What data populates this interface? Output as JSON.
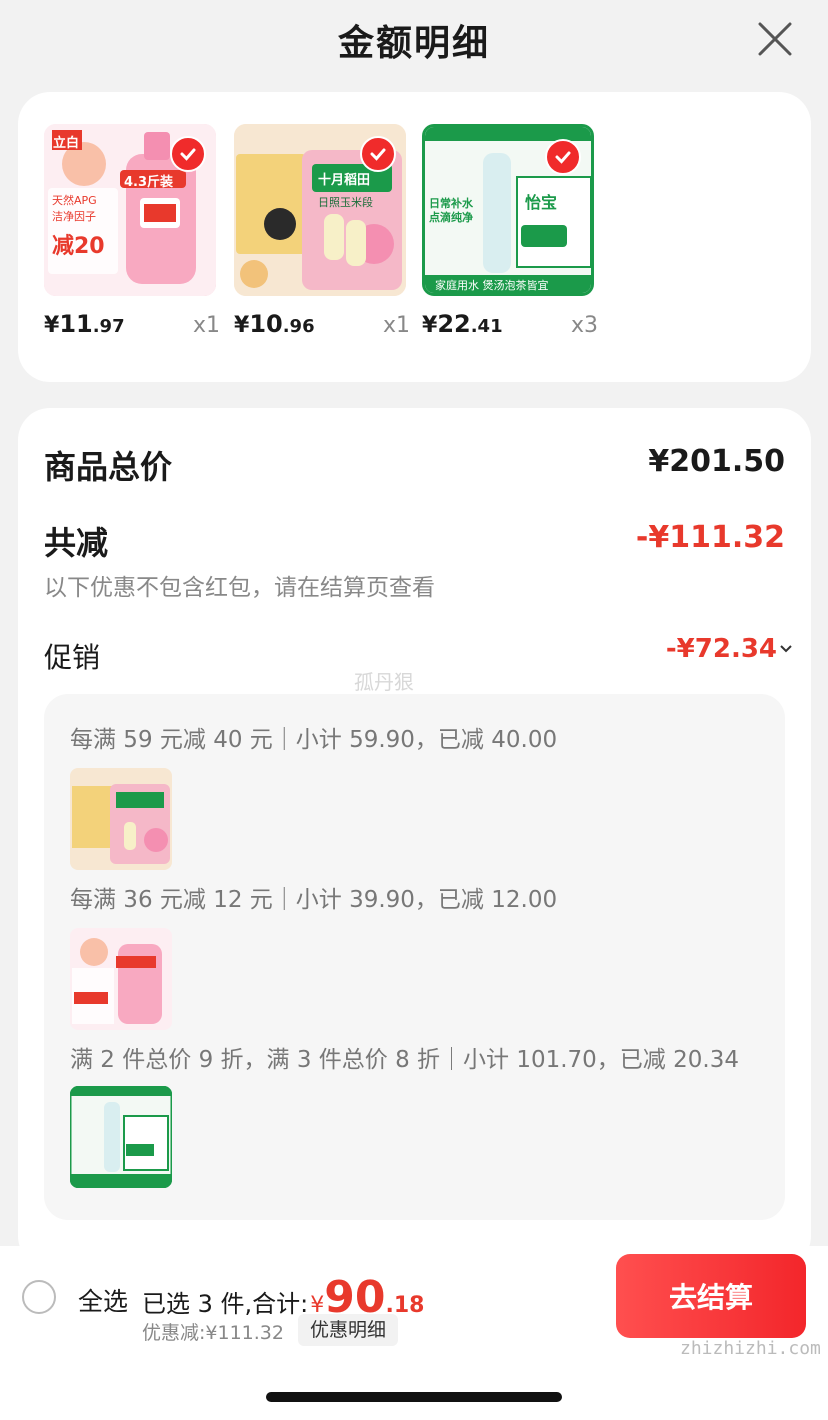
{
  "header": {
    "title": "金额明细",
    "close_icon": "close-icon"
  },
  "products": [
    {
      "price_yen": "¥",
      "price_int": "11",
      "price_dec": ".97",
      "qty": "x1",
      "brand": "立白",
      "badge": "4.3斤装",
      "tag1": "天然APG",
      "tag2": "洁净因子",
      "promo": "减20",
      "colors": {
        "bg": "#f8c7d3",
        "accent": "#e8392c"
      }
    },
    {
      "price_yen": "¥",
      "price_int": "10",
      "price_dec": ".96",
      "qty": "x1",
      "brand": "十月稻田",
      "badge": "日照玉米段",
      "colors": {
        "bg": "#f6c9d4",
        "accent": "#1b9a4a"
      }
    },
    {
      "price_yen": "¥",
      "price_int": "22",
      "price_dec": ".41",
      "qty": "x3",
      "brand": "怡宝",
      "tagline": "家庭用水 煲汤泡茶皆宜",
      "headline": "日常补水 点滴纯净",
      "colors": {
        "bg": "#1b9a4a",
        "accent": "#ffffff"
      }
    }
  ],
  "summary": {
    "total_label": "商品总价",
    "total_value": "¥201.50",
    "reduce_label": "共减",
    "reduce_value": "-¥111.32",
    "note": "以下优惠不包含红包，请在结算页查看",
    "promo_label": "促销",
    "promo_value": "-¥72.34",
    "watermark": "孤丹狠"
  },
  "promotions": [
    {
      "text": "每满 59 元减 40 元｜小计 59.90，已减 40.00",
      "thumb": "rice"
    },
    {
      "text": "每满 36 元减 12 元｜小计 39.90，已减 12.00",
      "thumb": "detergent"
    },
    {
      "text": "满 2 件总价 9 折，满 3 件总价 8 折｜小计 101.70，已减 20.34",
      "thumb": "water"
    }
  ],
  "bottom": {
    "select_all": "全选",
    "selected_prefix": "已选 3 件,合计:",
    "total_yen": "¥",
    "total_int": "90",
    "total_dec": ".18",
    "discount": "优惠减:¥111.32",
    "discount_detail": "优惠明细",
    "checkout": "去结算",
    "site_mark": "zhizhizhi.com"
  }
}
